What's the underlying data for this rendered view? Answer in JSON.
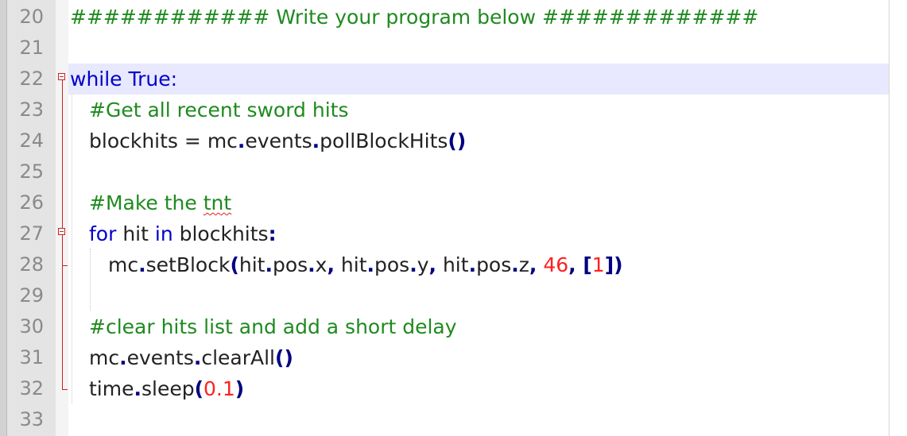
{
  "colors": {
    "keyword": "#0000cc",
    "comment": "#1f8a1f",
    "number": "#ff2020",
    "operator": "#000080",
    "current_line": "#e8e8ff"
  },
  "lines": [
    {
      "num": "20",
      "text": "############ Write your program below #############"
    },
    {
      "num": "21",
      "text": ""
    },
    {
      "num": "22",
      "kw1": "while",
      "kw2": "True",
      "colon": ":"
    },
    {
      "num": "23",
      "text": "#Get all recent sword hits"
    },
    {
      "num": "24",
      "pre": "blockhits",
      "eq": "=",
      "obj": "mc",
      "dot1": ".",
      "attr": "events",
      "dot2": ".",
      "fn": "pollBlockHits",
      "parens": "()"
    },
    {
      "num": "25",
      "text": ""
    },
    {
      "num": "26",
      "text": "#Make the ",
      "squiggle": "tnt"
    },
    {
      "num": "27",
      "kw1": "for",
      "var": " hit ",
      "kw2": "in",
      "iter": " blockhits",
      "colon": ":"
    },
    {
      "num": "28",
      "obj": "mc",
      "dot": ".",
      "fn": "setBlock",
      "open": "(",
      "a1": "hit",
      "d1": ".",
      "a1b": "pos",
      "d1b": ".",
      "a1c": "x",
      "c1": ",",
      "a2": " hit",
      "d2": ".",
      "a2b": "pos",
      "d2b": ".",
      "a2c": "y",
      "c2": ",",
      "a3": " hit",
      "d3": ".",
      "a3b": "pos",
      "d3b": ".",
      "a3c": "z",
      "c3": ",",
      "n1": " 46",
      "c4": ",",
      "lb": " [",
      "n2": "1",
      "rb": "]",
      "close": ")"
    },
    {
      "num": "29",
      "text": ""
    },
    {
      "num": "30",
      "text": "#clear hits list and add a short delay"
    },
    {
      "num": "31",
      "obj": "mc",
      "dot1": ".",
      "attr": "events",
      "dot2": ".",
      "fn": "clearAll",
      "parens": "()"
    },
    {
      "num": "32",
      "obj": "time",
      "dot": ".",
      "fn": "sleep",
      "open": "(",
      "n1": "0.1",
      "close": ")"
    },
    {
      "num": "33",
      "text": ""
    }
  ]
}
